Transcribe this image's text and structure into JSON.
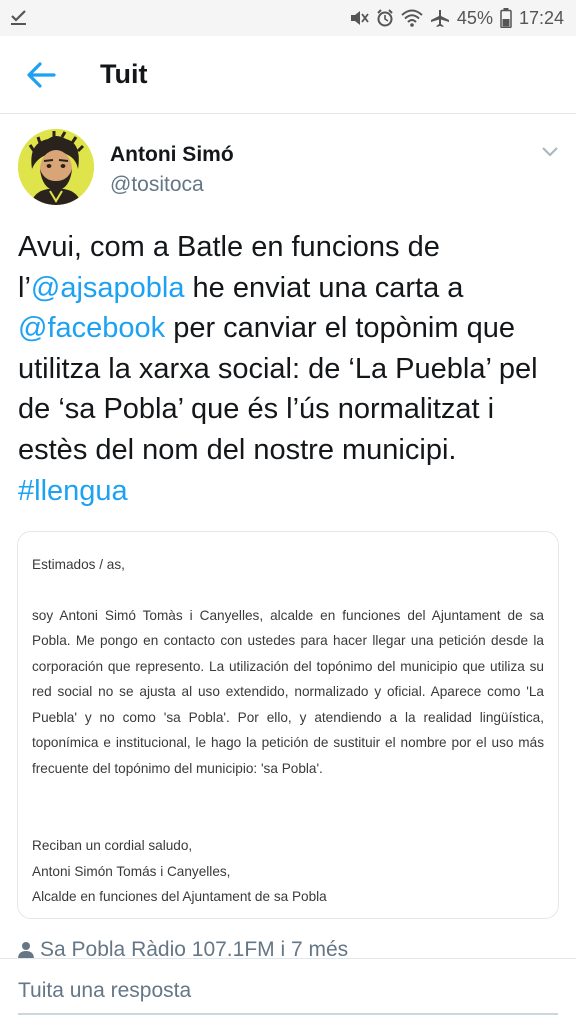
{
  "status_bar": {
    "battery": "45%",
    "time": "17:24",
    "left_icon": "download-check-icon"
  },
  "app_bar": {
    "title": "Tuit",
    "back_icon": "back-arrow-icon"
  },
  "tweet": {
    "author_name": "Antoni Simó",
    "author_handle": "@tositoca",
    "text": {
      "p1": "Avui, com a Batle en funcions de l’",
      "mention1": "@ajsapobla",
      "p2": " he enviat una carta a ",
      "mention2": "@facebook",
      "p3": " per canviar el topònim que utilitza la xarxa social: de ‘La Puebla’ pel de ‘sa Pobla’ que és l’ús normalitzat i estès del nom del nostre municipi. ",
      "hashtag": "#llengua"
    },
    "letter": {
      "greeting": "Estimados / as,",
      "body": "soy Antoni Simó Tomàs i Canyelles, alcalde en funciones del Ajuntament de sa Pobla. Me pongo en contacto con ustedes para hacer llegar una petición desde la corporación que represento. La utilización del topónimo del municipio que utiliza su red social no se ajusta al uso extendido, normalizado y oficial. Aparece como 'La Puebla' y no como 'sa Pobla'. Por ello, y atendiendo a la realidad lingüística, toponímica e institucional, le hago la petición de sustituir el nombre por el uso más frecuente del topónimo del municipio: 'sa Pobla'.",
      "closing1": "Reciban un cordial saludo,",
      "closing2": "Antoni Simón Tomás i Canyelles,",
      "closing3": "Alcalde en funciones del Ajuntament de sa Pobla"
    },
    "meta": "Sa Pobla Ràdio 107.1FM i 7 més"
  },
  "reply": {
    "placeholder": "Tuita una resposta"
  },
  "colors": {
    "accent": "#1da1f2",
    "text": "#14171a",
    "muted": "#657786",
    "avatar_bg": "#dfe44a"
  }
}
